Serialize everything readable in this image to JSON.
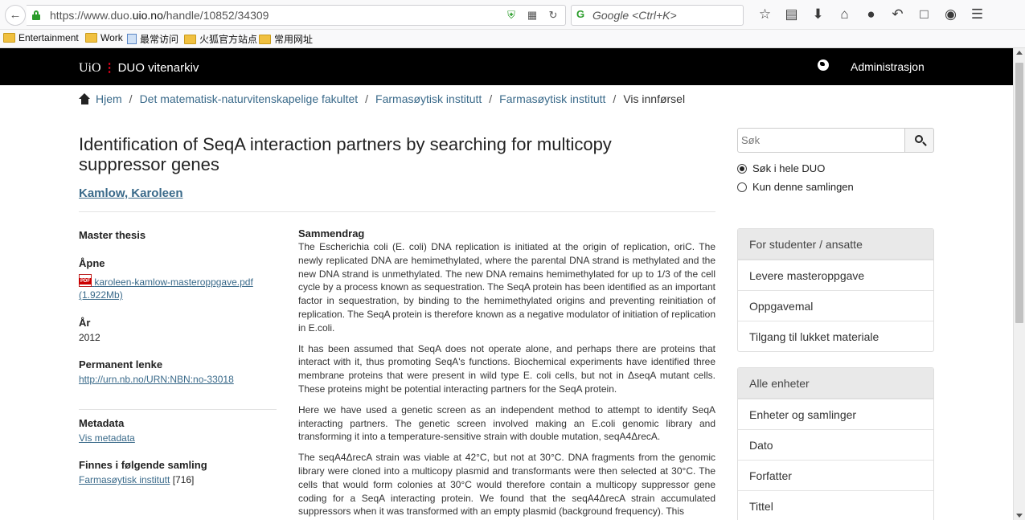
{
  "browser": {
    "url_prefix": "https://www.duo.",
    "url_host": "uio.no",
    "url_path": "/handle/10852/34309",
    "search_placeholder": "Google <Ctrl+K>",
    "bookmarks": [
      "Entertainment",
      "Work",
      "最常访问",
      "火狐官方站点",
      "常用网址"
    ]
  },
  "header": {
    "logo_text": "UiO",
    "brand": "DUO vitenarkiv",
    "admin_link": "Administrasjon"
  },
  "breadcrumb": {
    "home": "Hjem",
    "items": [
      "Det matematisk-naturvitenskapelige fakultet",
      "Farmasøytisk institutt",
      "Farmasøytisk institutt"
    ],
    "current": "Vis innførsel",
    "separator": "/"
  },
  "item": {
    "title": "Identification of SeqA interaction partners by searching for multicopy suppressor genes",
    "author": "Kamlow, Karoleen",
    "type": "Master thesis",
    "open_heading": "Åpne",
    "file_name": "karoleen-kamlow-masteroppgave.pdf",
    "file_size": "(1.922Mb)",
    "year_heading": "År",
    "year": "2012",
    "permalink_heading": "Permanent lenke",
    "permalink": "http://urn.nb.no/URN:NBN:no-33018",
    "metadata_heading": "Metadata",
    "metadata_link": "Vis metadata",
    "collection_heading": "Finnes i følgende samling",
    "collection_link": "Farmasøytisk institutt",
    "collection_count": "[716]"
  },
  "abstract": {
    "heading": "Sammendrag",
    "paragraphs": [
      "The Escherichia coli (E. coli) DNA replication is initiated at the origin of replication, oriC. The newly replicated DNA are hemimethylated, where the parental DNA strand is methylated and the new DNA strand is unmethylated. The new DNA remains hemimethylated for up to 1/3 of the cell cycle by a process known as sequestration. The SeqA protein has been identified as an important factor in sequestration, by binding to the hemimethylated origins and preventing reinitiation of replication. The SeqA protein is therefore known as a negative modulator of initiation of replication in E.coli.",
      "It has been assumed that SeqA does not operate alone, and perhaps there are proteins that interact with it, thus promoting SeqA's functions. Biochemical experiments have identified three membrane proteins that were present in wild type E. coli cells, but not in ΔseqA mutant cells. These proteins might be potential interacting partners for the SeqA protein.",
      "Here we have used a genetic screen as an independent method to attempt to identify SeqA interacting partners. The genetic screen involved making an E.coli genomic library and transforming it into a temperature-sensitive strain with double mutation, seqA4ΔrecA.",
      "The seqA4ΔrecA strain was viable at 42°C, but not at 30°C. DNA fragments from the genomic library were cloned into a multicopy plasmid and transformants were then selected at 30°C. The cells that would form colonies at 30°C would therefore contain a multicopy suppressor gene coding for a SeqA interacting protein. We found that the seqA4ΔrecA strain accumulated suppressors when it was transformed with an empty plasmid (background frequency). This"
    ]
  },
  "sidebar": {
    "search_placeholder": "Søk",
    "radio_all": "Søk i hele DUO",
    "radio_collection": "Kun denne samlingen",
    "panel1": {
      "heading": "For studenter / ansatte",
      "items": [
        "Levere masteroppgave",
        "Oppgavemal",
        "Tilgang til lukket materiale"
      ]
    },
    "panel2": {
      "heading": "Alle enheter",
      "items": [
        "Enheter og samlinger",
        "Dato",
        "Forfatter",
        "Tittel"
      ]
    }
  }
}
